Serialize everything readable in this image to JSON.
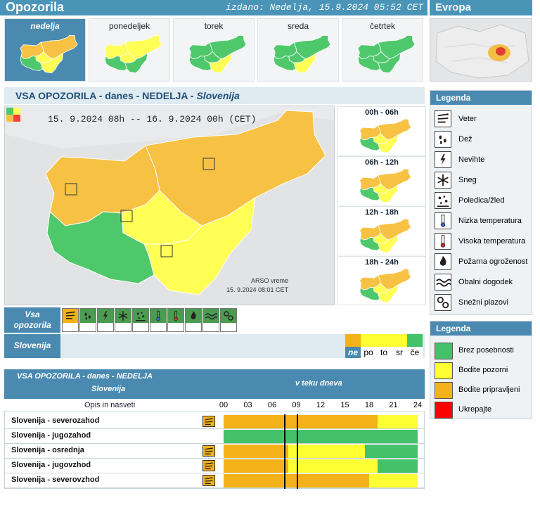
{
  "header": {
    "title": "Opozorila",
    "issued": "izdano: Nedelja, 15.9.2024 05:52 CET",
    "europe": "Evropa"
  },
  "days": [
    {
      "label": "nedelja",
      "active": true
    },
    {
      "label": "ponedeljek",
      "active": false
    },
    {
      "label": "torek",
      "active": false
    },
    {
      "label": "sreda",
      "active": false
    },
    {
      "label": "četrtek",
      "active": false
    }
  ],
  "main": {
    "heading_prefix": "VSA OPOZORILA - danes - NEDELJA - ",
    "heading_region": "Slovenija",
    "validity": "15. 9.2024 08h -- 16. 9.2024 00h   (CET)",
    "credit_line1": "ARSO vreme",
    "credit_line2": "15. 9.2024 08:01 CET"
  },
  "periods": [
    "00h - 06h",
    "06h - 12h",
    "12h - 18h",
    "18h - 24h"
  ],
  "legend_types": {
    "title": "Legenda",
    "items": [
      {
        "label": "Veter",
        "icon": "wind-icon"
      },
      {
        "label": "Dež",
        "icon": "rain-icon"
      },
      {
        "label": "Nevihte",
        "icon": "thunderstorm-icon"
      },
      {
        "label": "Sneg",
        "icon": "snow-icon"
      },
      {
        "label": "Poledica/žled",
        "icon": "ice-icon"
      },
      {
        "label": "Nizka temperatura",
        "icon": "low-temperature-icon"
      },
      {
        "label": "Visoka temperatura",
        "icon": "high-temperature-icon"
      },
      {
        "label": "Požarna ogroženost",
        "icon": "fire-danger-icon"
      },
      {
        "label": "Obalni dogodek",
        "icon": "coastal-event-icon"
      },
      {
        "label": "Snežni plazovi",
        "icon": "avalanche-icon"
      }
    ]
  },
  "legend_levels": {
    "title": "Legenda",
    "items": [
      {
        "label": "Brez posebnosti",
        "color": "#43c16b"
      },
      {
        "label": "Bodite pozorni",
        "color": "#ffff33"
      },
      {
        "label": "Bodite pripravljeni",
        "color": "#f3b21a"
      },
      {
        "label": "Ukrepajte",
        "color": "#ff0000"
      }
    ]
  },
  "type_strip": {
    "label_line1": "Vsa",
    "label_line2": "opozorila",
    "active_index": 0
  },
  "week_strip": {
    "label": "Slovenija",
    "days": [
      {
        "label": "ne",
        "color": "#f3b21a",
        "active": true
      },
      {
        "label": "po",
        "color": "#ffff33",
        "active": false
      },
      {
        "label": "to",
        "color": "#ffff33",
        "active": false
      },
      {
        "label": "sr",
        "color": "#ffff33",
        "active": false
      },
      {
        "label": "če",
        "color": "#43c16b",
        "active": false
      }
    ]
  },
  "table": {
    "title": "VSA OPOZORILA - danes - NEDELJA",
    "subtitle": "Slovenija",
    "timeline_label": "v teku dneva",
    "col_label": "Opis in nasveti",
    "hours": [
      "00",
      "03",
      "06",
      "09",
      "12",
      "15",
      "18",
      "21",
      "24"
    ],
    "rows": [
      {
        "name": "Slovenija - severozahod",
        "icon": true,
        "segments": [
          [
            "orange",
            0,
            19
          ],
          [
            "yellow",
            19,
            24
          ]
        ]
      },
      {
        "name": "Slovenija - jugozahod",
        "icon": false,
        "segments": [
          [
            "green",
            0,
            24
          ]
        ]
      },
      {
        "name": "Slovenija - osrednja",
        "icon": true,
        "segments": [
          [
            "orange",
            0,
            8
          ],
          [
            "yellow",
            8,
            17.5
          ],
          [
            "green",
            17.5,
            24
          ]
        ]
      },
      {
        "name": "Slovenija - jugovzhod",
        "icon": true,
        "segments": [
          [
            "orange",
            0,
            8
          ],
          [
            "yellow",
            8,
            19
          ],
          [
            "green",
            19,
            24
          ]
        ]
      },
      {
        "name": "Slovenija - severovzhod",
        "icon": true,
        "segments": [
          [
            "orange",
            0,
            18
          ],
          [
            "yellow",
            18,
            24
          ]
        ]
      }
    ]
  }
}
